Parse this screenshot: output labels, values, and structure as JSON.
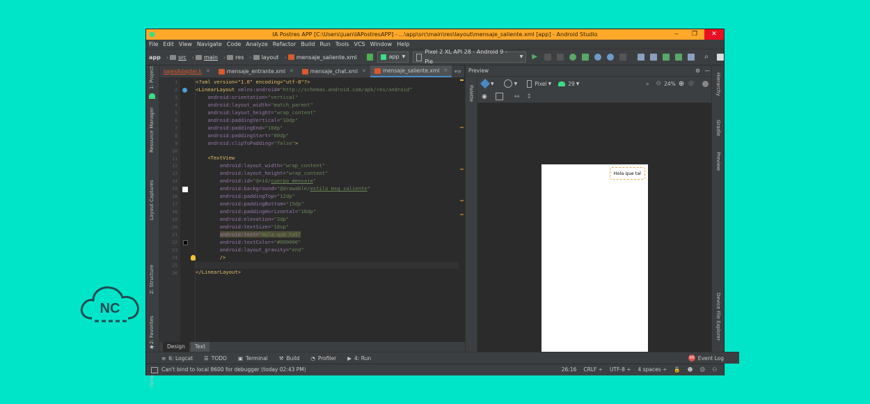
{
  "window": {
    "title": "IA Postres APP [C:\\Users\\juan\\IAPostresAPP] - ...\\app\\src\\main\\res\\layout\\mensaje_saliente.xml [app] - Android Studio",
    "controls": [
      "‒",
      "❐",
      "✕"
    ]
  },
  "menu": [
    "File",
    "Edit",
    "View",
    "Navigate",
    "Code",
    "Analyze",
    "Refactor",
    "Build",
    "Run",
    "Tools",
    "VCS",
    "Window",
    "Help"
  ],
  "breadcrumb": [
    "app",
    "src",
    "main",
    "res",
    "layout",
    "mensaje_saliente.xml"
  ],
  "run_config": "app",
  "device": "Pixel 2 XL API 28 - Android 9 - Pie",
  "editor_tabs": [
    {
      "label": "sajesAdapter.k",
      "active": false
    },
    {
      "label": "mensaje_entrante.xml",
      "active": false
    },
    {
      "label": "mensaje_chat.xml",
      "active": false
    },
    {
      "label": "mensaje_saliente.xml",
      "active": true
    }
  ],
  "code_lines": [
    "1",
    "2",
    "3",
    "4",
    "5",
    "6",
    "7",
    "8",
    "9",
    "10",
    "11",
    "12",
    "13",
    "14",
    "15",
    "16",
    "17",
    "18",
    "19",
    "20",
    "21",
    "22",
    "23",
    "24",
    "25",
    "26"
  ],
  "code": {
    "l1_pi": "<?xml version=\"1.0\" encoding=\"utf-8\"?>",
    "l2_tag": "<LinearLayout",
    "l2_ns": "xmlns:android",
    "l2_val": "\"http://schemas.android.com/apk/res/android\"",
    "l3_attr": "android:orientation=",
    "l3_val": "\"vertical\"",
    "l4_attr": "android:layout_width=",
    "l4_val": "\"match_parent\"",
    "l5_attr": "android:layout_height=",
    "l5_val": "\"wrap_content\"",
    "l6_attr": "android:paddingVertical=",
    "l6_val": "\"10dp\"",
    "l7_attr": "android:paddingEnd=",
    "l7_val": "\"10dp\"",
    "l8_attr": "android:paddingStart=",
    "l8_val": "\"80dp\"",
    "l9_attr": "android:clipToPadding=",
    "l9_val": "\"false\"",
    "l9_end": ">",
    "l11_tag": "<TextView",
    "l12_attr": "android:layout_width=",
    "l12_val": "\"wrap_content\"",
    "l13_attr": "android:layout_height=",
    "l13_val": "\"wrap_content\"",
    "l14_attr": "android:id=",
    "l14_val_a": "\"@+id/",
    "l14_val_b": "cuerpo_mensaje",
    "l14_val_c": "\"",
    "l15_attr": "android:background=",
    "l15_val_a": "\"@drawable/",
    "l15_val_b": "estilo_msg_saliente",
    "l15_val_c": "\"",
    "l16_attr": "android:paddingTop=",
    "l16_val": "\"12dp\"",
    "l17_attr": "android:paddingBottom=",
    "l17_val": "\"15dp\"",
    "l18_attr": "android:paddingHorizontal=",
    "l18_val": "\"16dp\"",
    "l19_attr": "android:elevation=",
    "l19_val": "\"2dp\"",
    "l20_attr": "android:textSize=",
    "l20_val": "\"18sp\"",
    "l21_attr": "android:text=",
    "l21_val": "\"Hola que tal\"",
    "l22_attr": "android:textColor=",
    "l22_val": "\"#000000\"",
    "l23_attr": "android:layout_gravity=",
    "l23_val": "\"end\"",
    "l24_tag": "/>",
    "l26_tag": "</LinearLayout>"
  },
  "editor_bottom_tabs": [
    "Design",
    "Text"
  ],
  "left_tools": [
    "1: Project",
    "Resource Manager",
    "Layout Captures",
    "Z: Structure",
    "2: Favorites",
    "Variants"
  ],
  "right_tools": [
    "Hierarchy",
    "Gradle",
    "Preview",
    "Device File Explorer"
  ],
  "preview": {
    "header": "Preview",
    "palette": "Palette",
    "device": "Pixel",
    "api": "29",
    "zoom": "24%",
    "bubble_text": "Hola que tal"
  },
  "tool_windows": [
    {
      "label": "6: Logcat",
      "icon": "logcat-icon"
    },
    {
      "label": "TODO",
      "icon": "todo-icon"
    },
    {
      "label": "Terminal",
      "icon": "terminal-icon"
    },
    {
      "label": "Build",
      "icon": "build-icon"
    },
    {
      "label": "Profiler",
      "icon": "profiler-icon"
    },
    {
      "label": "4: Run",
      "icon": "run-icon"
    }
  ],
  "event_log": "Event Log",
  "event_badge": "99",
  "status": {
    "message": "Can't bind to local 8600 for debugger (today 02:43 PM)",
    "position": "26:16",
    "line_sep": "CRLF ÷",
    "encoding": "UTF-8 ÷",
    "indent": "4 spaces ÷"
  },
  "logo_text": "NC",
  "colors": {
    "background": "#00e5c8",
    "titlebar": "#ffa829",
    "ide_dark": "#2b2b2b",
    "ide_panel": "#3c3f41",
    "logo": "#1e4b50"
  }
}
